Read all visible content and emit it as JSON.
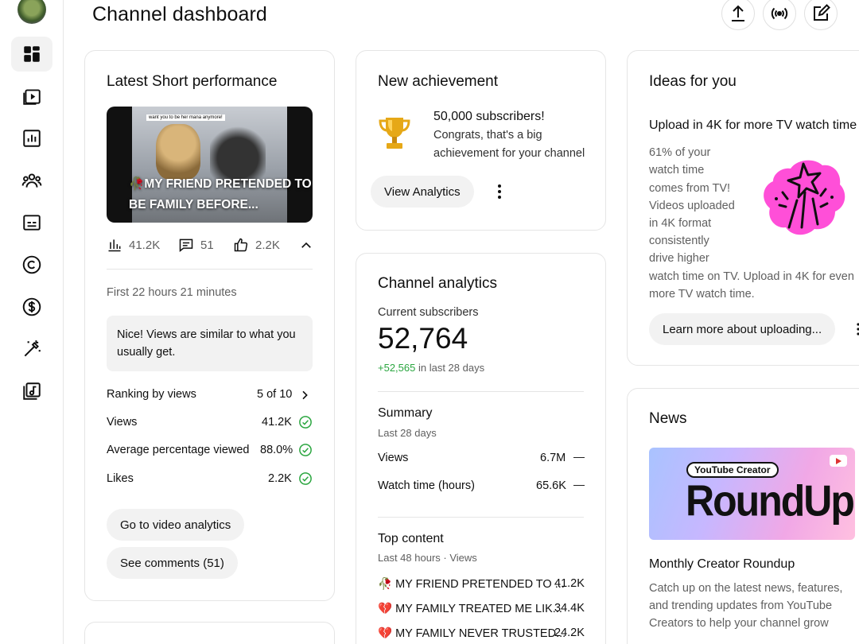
{
  "header": {
    "title": "Channel dashboard",
    "actions": [
      {
        "name": "upload-icon"
      },
      {
        "name": "go-live-icon"
      },
      {
        "name": "create-post-icon"
      }
    ]
  },
  "sidebar": {
    "items": [
      {
        "name": "dashboard",
        "icon": "dashboard-icon",
        "active": true
      },
      {
        "name": "content",
        "icon": "content-icon"
      },
      {
        "name": "analytics",
        "icon": "analytics-icon"
      },
      {
        "name": "community",
        "icon": "community-icon"
      },
      {
        "name": "subtitles",
        "icon": "subtitles-icon"
      },
      {
        "name": "copyright",
        "icon": "copyright-icon"
      },
      {
        "name": "earn",
        "icon": "dollar-icon"
      },
      {
        "name": "customization",
        "icon": "magic-wand-icon"
      },
      {
        "name": "audio-library",
        "icon": "audio-library-icon"
      }
    ]
  },
  "short_perf": {
    "title": "Latest Short performance",
    "thumbnail": {
      "caption_emoji": "🥀",
      "caption": "MY FRIEND PRETENDED TO BE FAMILY BEFORE...",
      "top_text": "want you to be her mana anymore!"
    },
    "stats": {
      "views": "41.2K",
      "comments": "51",
      "likes": "2.2K"
    },
    "period": "First 22 hours 21 minutes",
    "insight": "Nice! Views are similar to what you usually get.",
    "metrics": [
      {
        "label": "Ranking by views",
        "value": "5 of 10"
      },
      {
        "label": "Views",
        "value": "41.2K"
      },
      {
        "label": "Average percentage viewed",
        "value": "88.0%"
      },
      {
        "label": "Likes",
        "value": "2.2K"
      }
    ],
    "btn_analytics": "Go to video analytics",
    "btn_comments": "See comments (51)"
  },
  "achievement": {
    "title": "New achievement",
    "heading": "50,000 subscribers!",
    "body_line1": "Congrats, that's a big",
    "body_line2": "achievement for your channel",
    "btn": "View Analytics"
  },
  "analytics": {
    "title": "Channel analytics",
    "subs_label": "Current subscribers",
    "subs_value": "52,764",
    "subs_delta": "+52,565",
    "subs_delta_suffix": "in last 28 days",
    "summary_title": "Summary",
    "summary_period": "Last 28 days",
    "summary": [
      {
        "label": "Views",
        "value": "6.7M",
        "trend": "—"
      },
      {
        "label": "Watch time (hours)",
        "value": "65.6K",
        "trend": "—"
      }
    ],
    "top_title": "Top content",
    "top_period": "Last 48 hours · Views",
    "top": [
      {
        "emoji": "🥀",
        "title": "MY FRIEND PRETENDED TO ...",
        "value": "41.2K"
      },
      {
        "emoji": "💔",
        "title": "MY FAMILY TREATED ME LIK...",
        "value": "34.4K"
      },
      {
        "emoji": "💔",
        "title": "MY FAMILY NEVER TRUSTED...",
        "value": "24.2K"
      }
    ]
  },
  "ideas": {
    "title": "Ideas for you",
    "heading": "Upload in 4K for more TV watch time",
    "lines": [
      "61% of your",
      "watch time",
      "comes from TV!",
      "Videos uploaded",
      "in 4K format",
      "consistently",
      "drive higher"
    ],
    "tail1": "watch time on TV. Upload in 4K for even",
    "tail2": "more TV watch time.",
    "btn": "Learn more about uploading..."
  },
  "news": {
    "title": "News",
    "badge": "YouTube Creator",
    "big": "RoundUp",
    "heading": "Monthly Creator Roundup",
    "line1": "Catch up on the latest news, features,",
    "line2": "and trending updates from YouTube",
    "line3": "Creators to help your channel grow"
  },
  "colors": {
    "accent_green": "#2ba640",
    "pill_bg": "#f2f2f2",
    "trophy": "#e6a817",
    "sparkle": "#ff4fd8"
  }
}
